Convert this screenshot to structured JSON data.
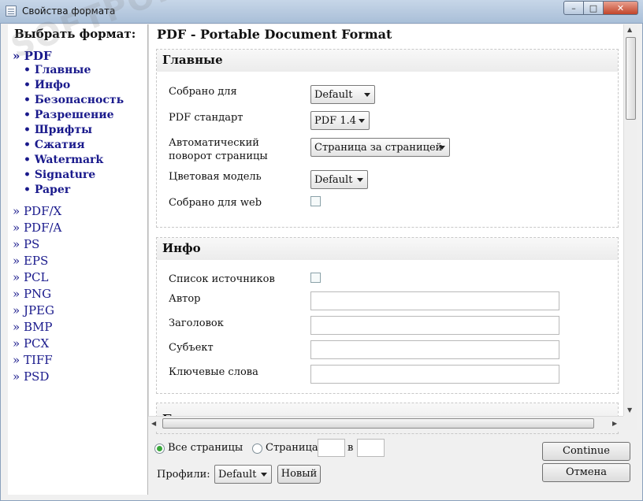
{
  "window": {
    "title": "Свойства формата",
    "minimize_label": "–",
    "maximize_label": "□",
    "close_label": "✕"
  },
  "sidebar": {
    "heading": "Выбрать формат:",
    "active": "» PDF",
    "subitems": [
      "• Главные",
      "• Инфо",
      "• Безопасность",
      "• Разрешение",
      "• Шрифты",
      "• Сжатия",
      "• Watermark",
      "• Signature",
      "• Paper"
    ],
    "formats": [
      "» PDF/X",
      "» PDF/A",
      "» PS",
      "» EPS",
      "» PCL",
      "» PNG",
      "» JPEG",
      "» BMP",
      "» PCX",
      "» TIFF",
      "» PSD"
    ]
  },
  "content": {
    "title": "PDF - Portable Document Format",
    "main_section": {
      "title": "Главные",
      "compiled_for_label": "Собрано для",
      "compiled_for_value": "Default",
      "pdf_standard_label": "PDF стандарт",
      "pdf_standard_value": "PDF 1.4",
      "autorotate_label_line1": "Автоматический",
      "autorotate_label_line2": "поворот страницы",
      "autorotate_value": "Страница за страницей",
      "color_model_label": "Цветовая модель",
      "color_model_value": "Default",
      "web_label": "Собрано для web",
      "web_checked": false
    },
    "info_section": {
      "title": "Инфо",
      "sources_label": "Список источников",
      "sources_checked": false,
      "author_label": "Автор",
      "author_value": "",
      "heading_label": "Заголовок",
      "heading_value": "",
      "subject_label": "Субъект",
      "subject_value": "",
      "keywords_label": "Ключевые слова",
      "keywords_value": ""
    },
    "security_section": {
      "title": "Безопасность"
    }
  },
  "bottom": {
    "all_pages_label": "Все страницы",
    "page_label": "Страница",
    "to_label": "в",
    "page_from": "",
    "page_to": "",
    "profiles_label": "Профили:",
    "profile_value": "Default",
    "new_label": "Новый",
    "continue_label": "Continue",
    "cancel_label": "Отмена"
  },
  "watermark_text": "SOFTPORTAL",
  "colors": {
    "nav_link": "#1a1a8c",
    "radio_selected": "#39a83a",
    "title_bar": "#b9cbe0",
    "close_button": "#c2452a"
  }
}
